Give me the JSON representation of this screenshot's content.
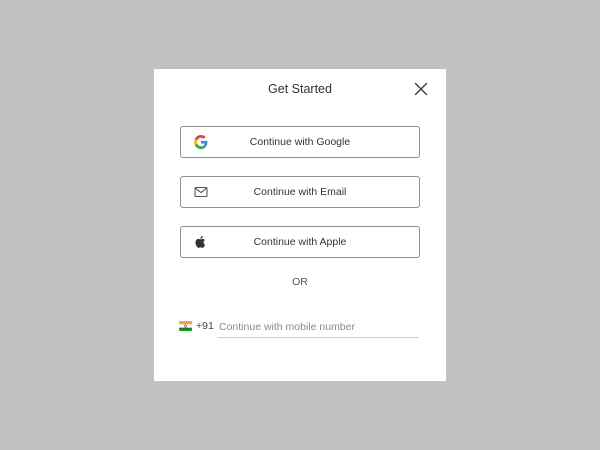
{
  "modal": {
    "title": "Get Started",
    "close_icon": "close-icon"
  },
  "auth_buttons": [
    {
      "label": "Continue with Google",
      "icon": "google-icon"
    },
    {
      "label": "Continue with Email",
      "icon": "mail-icon"
    },
    {
      "label": "Continue with Apple",
      "icon": "apple-icon"
    }
  ],
  "separator": {
    "text": "OR"
  },
  "phone": {
    "flag_icon": "india-flag-icon",
    "country_code": "+91",
    "placeholder": "Continue with mobile number",
    "value": ""
  },
  "colors": {
    "backdrop": "#c1c1c1",
    "modal_bg": "#ffffff",
    "button_border": "#8f8f8f",
    "text": "#333333",
    "google_blue": "#4285F4",
    "google_red": "#EA4335",
    "google_yellow": "#FBBC05",
    "google_green": "#34A853"
  }
}
